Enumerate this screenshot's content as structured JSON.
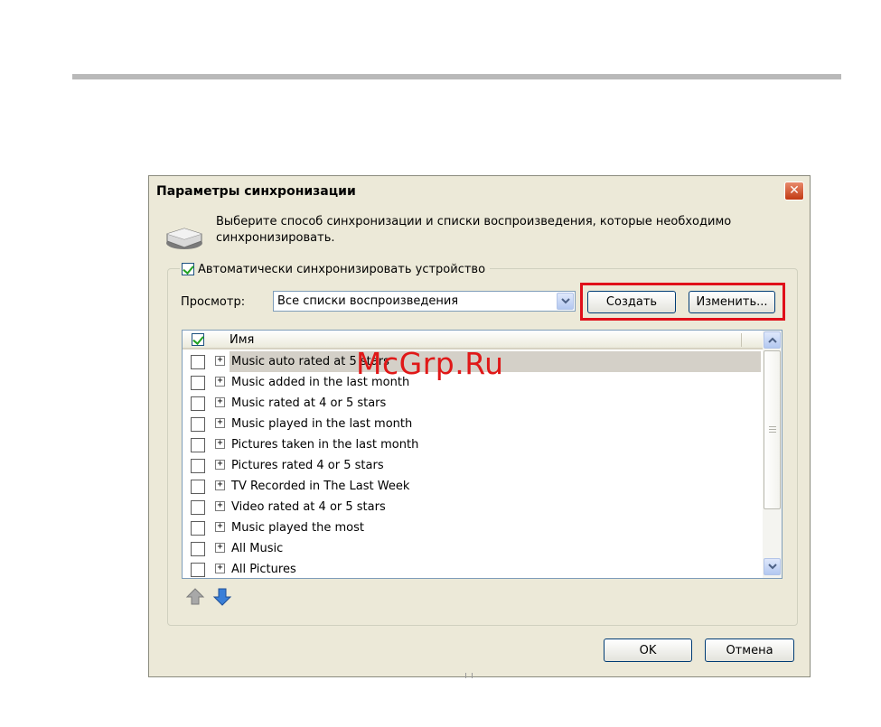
{
  "watermark": "McGrp.Ru",
  "dialog": {
    "title": "Параметры синхронизации",
    "close_symbol": "✕",
    "intro_line1": "Выберите способ синхронизации и списки воспроизведения, которые необходимо",
    "intro_line2": "синхронизировать.",
    "auto_sync": {
      "label": "Автоматически синхронизировать устройство",
      "checked": true
    },
    "view": {
      "label": "Просмотр:",
      "value": "Все списки воспроизведения"
    },
    "buttons": {
      "create": "Создать",
      "edit": "Изменить...",
      "ok": "OK",
      "cancel": "Отмена"
    },
    "list": {
      "header_name": "Имя",
      "items": [
        "Music auto rated at 5 stars",
        "Music added in the last month",
        "Music rated at 4 or 5 stars",
        "Music played in the last month",
        "Pictures taken in the last month",
        "Pictures rated 4 or 5 stars",
        "TV Recorded in The Last Week",
        "Video rated at 4 or 5 stars",
        "Music played the most",
        "All Music",
        "All Pictures"
      ],
      "selected_index": 0
    }
  },
  "colors": {
    "highlight": "#e0101a",
    "dialog_bg": "#ece9d8",
    "watermark": "#e01818"
  },
  "icons": [
    "device-icon",
    "close-icon",
    "chevron-down-icon",
    "move-up-icon",
    "move-down-icon",
    "scroll-up-icon",
    "scroll-down-icon",
    "expand-icon"
  ]
}
